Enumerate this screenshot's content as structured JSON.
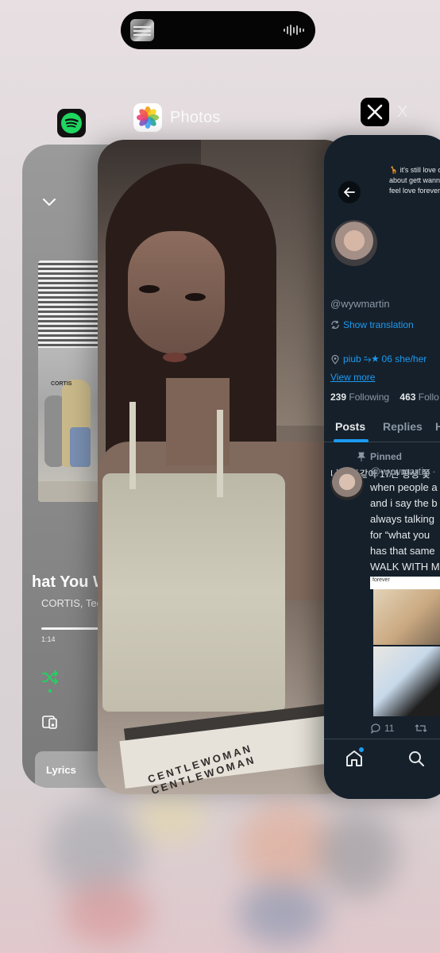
{
  "apps": {
    "spotify": {
      "name": ""
    },
    "photos": {
      "name": "Photos"
    },
    "x": {
      "name": "X"
    }
  },
  "spotify": {
    "song_title": "hat You W",
    "artist": "CORTIS, Tee",
    "elapsed": "1:14",
    "lyrics_label": "Lyrics",
    "accent": "#1ed760",
    "art_sign": "CORTIS"
  },
  "photos": {
    "waistband_text": "CENTLEWOMAN CENTLEWOMAN"
  },
  "x": {
    "banner_text": "🦒 it's still love only about gett wanna feel love forever",
    "handle": "@wywmartin",
    "show_translation": "Show translation",
    "bio": "나도 똑같아 17년 평생 쫓",
    "location": "piub ⥲★ 06 she/her",
    "view_more": "View more",
    "following_count": "239",
    "following_label": "Following",
    "followers_count": "463",
    "followers_label": "Follo",
    "tabs": [
      "Posts",
      "Replies",
      "H"
    ],
    "pinned_label": "Pinned",
    "post": {
      "handle": "@wywmartin ·",
      "lines": [
        "when people a",
        "and i say the b",
        "always talking",
        "for “what you",
        "has that same",
        "WALK WITH M"
      ],
      "image_caption": "forever",
      "replies": "11"
    },
    "accent": "#1d9bf0"
  }
}
